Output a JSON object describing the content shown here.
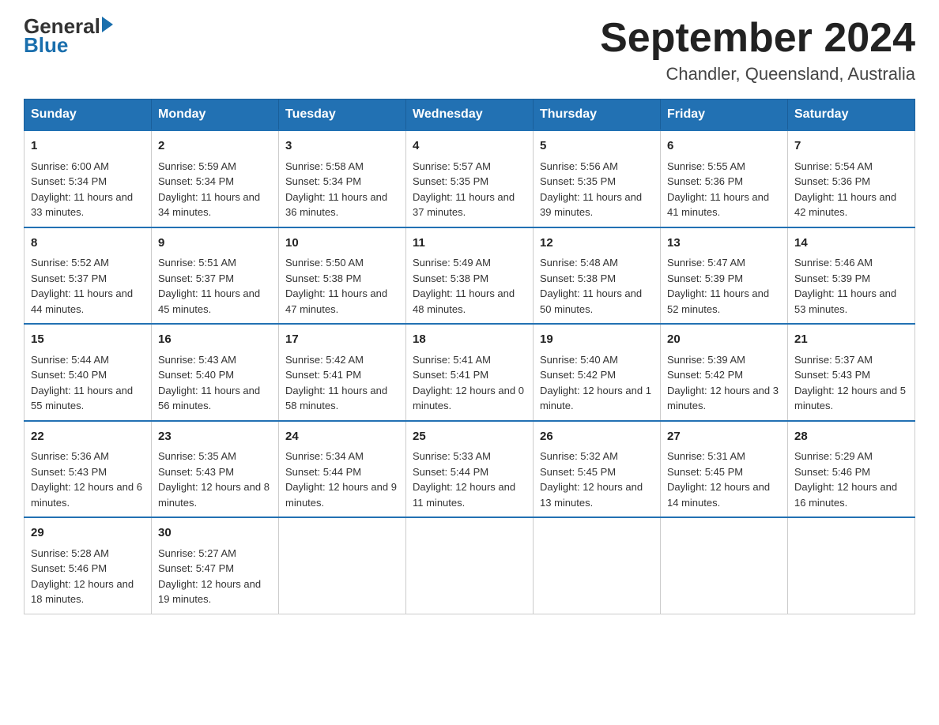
{
  "header": {
    "logo_text_general": "General",
    "logo_text_blue": "Blue",
    "month_title": "September 2024",
    "location": "Chandler, Queensland, Australia"
  },
  "days_of_week": [
    "Sunday",
    "Monday",
    "Tuesday",
    "Wednesday",
    "Thursday",
    "Friday",
    "Saturday"
  ],
  "weeks": [
    [
      {
        "day": "1",
        "sunrise": "6:00 AM",
        "sunset": "5:34 PM",
        "daylight": "11 hours and 33 minutes."
      },
      {
        "day": "2",
        "sunrise": "5:59 AM",
        "sunset": "5:34 PM",
        "daylight": "11 hours and 34 minutes."
      },
      {
        "day": "3",
        "sunrise": "5:58 AM",
        "sunset": "5:34 PM",
        "daylight": "11 hours and 36 minutes."
      },
      {
        "day": "4",
        "sunrise": "5:57 AM",
        "sunset": "5:35 PM",
        "daylight": "11 hours and 37 minutes."
      },
      {
        "day": "5",
        "sunrise": "5:56 AM",
        "sunset": "5:35 PM",
        "daylight": "11 hours and 39 minutes."
      },
      {
        "day": "6",
        "sunrise": "5:55 AM",
        "sunset": "5:36 PM",
        "daylight": "11 hours and 41 minutes."
      },
      {
        "day": "7",
        "sunrise": "5:54 AM",
        "sunset": "5:36 PM",
        "daylight": "11 hours and 42 minutes."
      }
    ],
    [
      {
        "day": "8",
        "sunrise": "5:52 AM",
        "sunset": "5:37 PM",
        "daylight": "11 hours and 44 minutes."
      },
      {
        "day": "9",
        "sunrise": "5:51 AM",
        "sunset": "5:37 PM",
        "daylight": "11 hours and 45 minutes."
      },
      {
        "day": "10",
        "sunrise": "5:50 AM",
        "sunset": "5:38 PM",
        "daylight": "11 hours and 47 minutes."
      },
      {
        "day": "11",
        "sunrise": "5:49 AM",
        "sunset": "5:38 PM",
        "daylight": "11 hours and 48 minutes."
      },
      {
        "day": "12",
        "sunrise": "5:48 AM",
        "sunset": "5:38 PM",
        "daylight": "11 hours and 50 minutes."
      },
      {
        "day": "13",
        "sunrise": "5:47 AM",
        "sunset": "5:39 PM",
        "daylight": "11 hours and 52 minutes."
      },
      {
        "day": "14",
        "sunrise": "5:46 AM",
        "sunset": "5:39 PM",
        "daylight": "11 hours and 53 minutes."
      }
    ],
    [
      {
        "day": "15",
        "sunrise": "5:44 AM",
        "sunset": "5:40 PM",
        "daylight": "11 hours and 55 minutes."
      },
      {
        "day": "16",
        "sunrise": "5:43 AM",
        "sunset": "5:40 PM",
        "daylight": "11 hours and 56 minutes."
      },
      {
        "day": "17",
        "sunrise": "5:42 AM",
        "sunset": "5:41 PM",
        "daylight": "11 hours and 58 minutes."
      },
      {
        "day": "18",
        "sunrise": "5:41 AM",
        "sunset": "5:41 PM",
        "daylight": "12 hours and 0 minutes."
      },
      {
        "day": "19",
        "sunrise": "5:40 AM",
        "sunset": "5:42 PM",
        "daylight": "12 hours and 1 minute."
      },
      {
        "day": "20",
        "sunrise": "5:39 AM",
        "sunset": "5:42 PM",
        "daylight": "12 hours and 3 minutes."
      },
      {
        "day": "21",
        "sunrise": "5:37 AM",
        "sunset": "5:43 PM",
        "daylight": "12 hours and 5 minutes."
      }
    ],
    [
      {
        "day": "22",
        "sunrise": "5:36 AM",
        "sunset": "5:43 PM",
        "daylight": "12 hours and 6 minutes."
      },
      {
        "day": "23",
        "sunrise": "5:35 AM",
        "sunset": "5:43 PM",
        "daylight": "12 hours and 8 minutes."
      },
      {
        "day": "24",
        "sunrise": "5:34 AM",
        "sunset": "5:44 PM",
        "daylight": "12 hours and 9 minutes."
      },
      {
        "day": "25",
        "sunrise": "5:33 AM",
        "sunset": "5:44 PM",
        "daylight": "12 hours and 11 minutes."
      },
      {
        "day": "26",
        "sunrise": "5:32 AM",
        "sunset": "5:45 PM",
        "daylight": "12 hours and 13 minutes."
      },
      {
        "day": "27",
        "sunrise": "5:31 AM",
        "sunset": "5:45 PM",
        "daylight": "12 hours and 14 minutes."
      },
      {
        "day": "28",
        "sunrise": "5:29 AM",
        "sunset": "5:46 PM",
        "daylight": "12 hours and 16 minutes."
      }
    ],
    [
      {
        "day": "29",
        "sunrise": "5:28 AM",
        "sunset": "5:46 PM",
        "daylight": "12 hours and 18 minutes."
      },
      {
        "day": "30",
        "sunrise": "5:27 AM",
        "sunset": "5:47 PM",
        "daylight": "12 hours and 19 minutes."
      },
      null,
      null,
      null,
      null,
      null
    ]
  ]
}
